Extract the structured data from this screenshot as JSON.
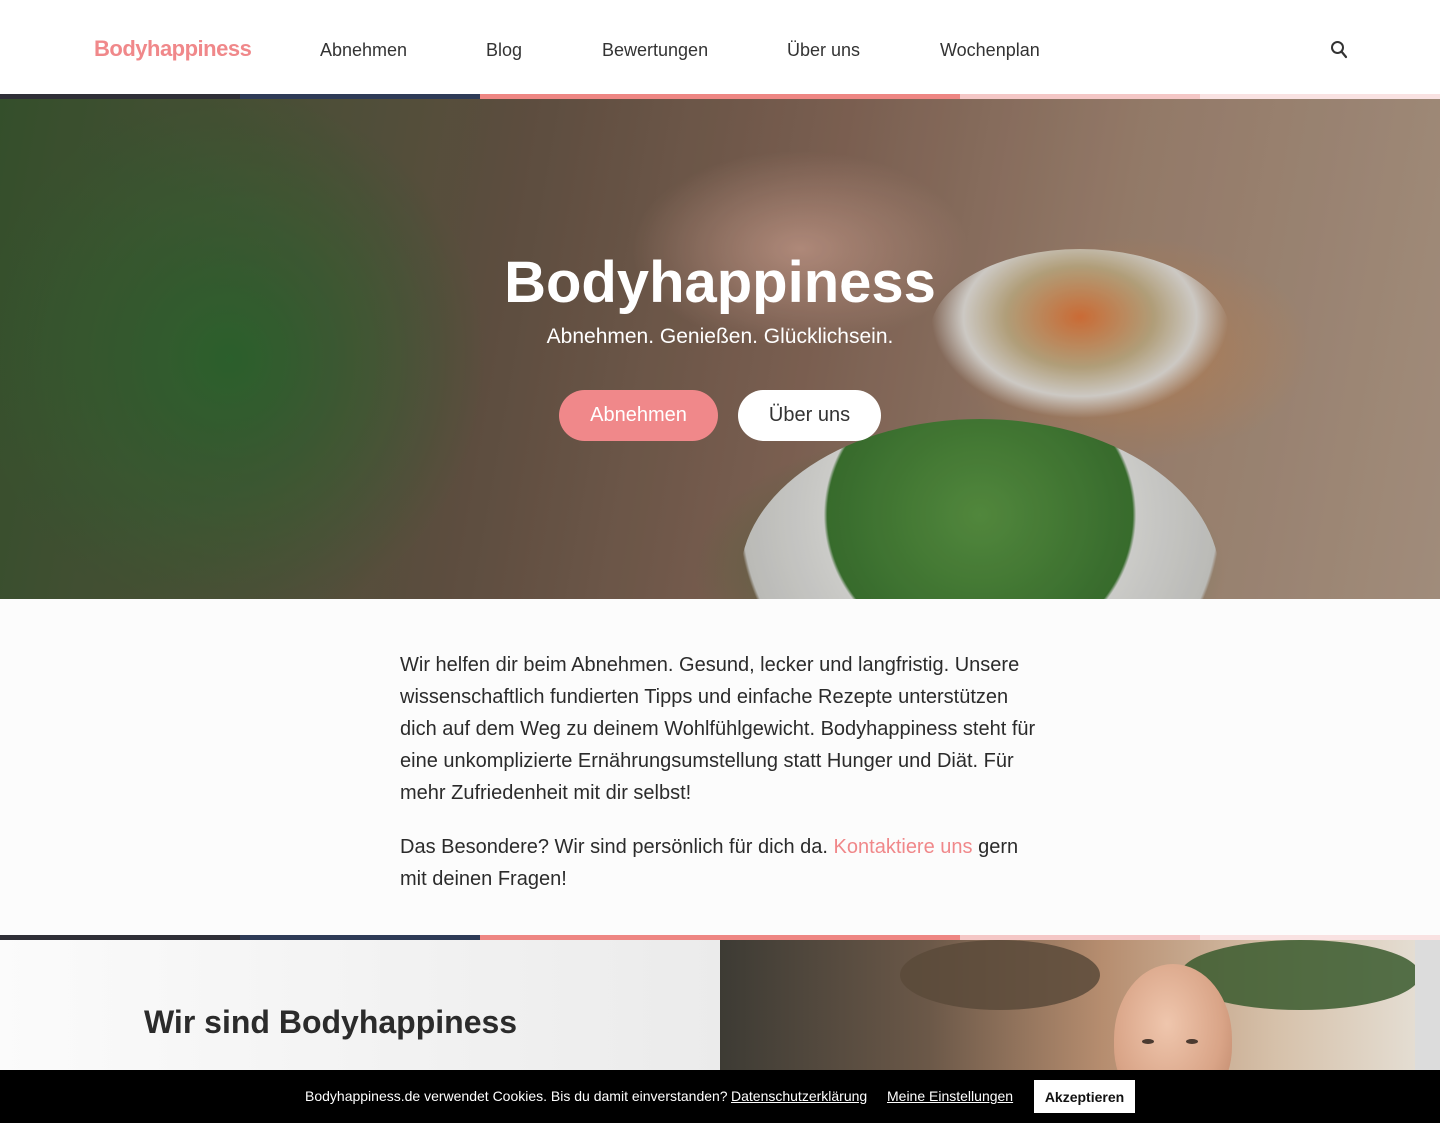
{
  "header": {
    "logo": "Bodyhappiness",
    "nav": [
      {
        "label": "Abnehmen"
      },
      {
        "label": "Blog"
      },
      {
        "label": "Bewertungen"
      },
      {
        "label": "Über uns"
      },
      {
        "label": "Wochenplan"
      }
    ],
    "search_icon": "search-icon"
  },
  "colors": {
    "accent": "#f0888a",
    "stripe": [
      "#2f2f37",
      "#2e3b57",
      "#ee8683",
      "#f4c7c6",
      "#f9e2e2"
    ]
  },
  "hero": {
    "title": "Bodyhappiness",
    "subtitle": "Abnehmen. Genießen. Glücklichsein.",
    "primary_button": "Abnehmen",
    "secondary_button": "Über uns"
  },
  "intro": {
    "paragraph1": "Wir helfen dir beim Abnehmen. Gesund, lecker und langfristig. Unsere wissenschaftlich fundierten Tipps und einfache Rezepte unterstützen dich auf dem Weg zu deinem Wohlfühlgewicht. Bodyhappiness steht für eine unkomplizierte Ernährungsumstellung statt Hunger und Diät. Für mehr Zufriedenheit mit dir selbst!",
    "paragraph2_before": "Das Besondere? Wir sind persönlich für dich da. ",
    "paragraph2_link": "Kontaktiere uns",
    "paragraph2_after": " gern mit deinen Fragen!"
  },
  "about": {
    "title": "Wir sind Bodyhappiness"
  },
  "cookie": {
    "text": "Bodyhappiness.de verwendet Cookies. Bis du damit einverstanden?",
    "privacy_link": "Datenschutzerklärung",
    "settings_link": "Meine Einstellungen",
    "accept_button": "Akzeptieren"
  }
}
